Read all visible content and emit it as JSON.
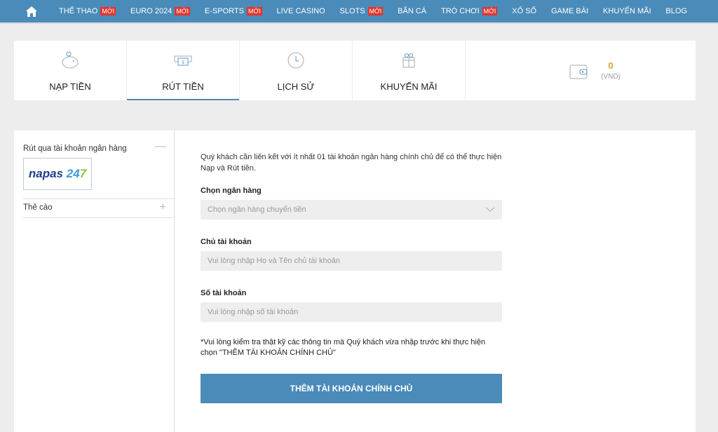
{
  "nav": {
    "items": [
      {
        "label": "THỂ THAO",
        "badge": "MỚI"
      },
      {
        "label": "EURO 2024",
        "badge": "MỚI"
      },
      {
        "label": "E-SPORTS",
        "badge": "MỚI"
      },
      {
        "label": "LIVE CASINO"
      },
      {
        "label": "SLOTS",
        "badge": "MỚI"
      },
      {
        "label": "BẮN CÁ"
      },
      {
        "label": "TRÒ CHƠI",
        "badge": "MỚI"
      },
      {
        "label": "XỔ SỐ"
      },
      {
        "label": "GAME BÀI"
      },
      {
        "label": "KHUYẾN MÃI"
      },
      {
        "label": "BLOG"
      }
    ]
  },
  "tabs": [
    {
      "label": "NẠP TIỀN",
      "icon": "piggy-bank-icon"
    },
    {
      "label": "RÚT TIỀN",
      "icon": "cash-withdraw-icon",
      "active": true
    },
    {
      "label": "LỊCH SỬ",
      "icon": "history-icon"
    },
    {
      "label": "KHUYẾN MÃI",
      "icon": "gift-icon"
    }
  ],
  "wallet": {
    "balance": "0",
    "currency": "(VND)"
  },
  "sidebar": {
    "section1": {
      "label": "Rút qua tài khoản ngân hàng",
      "logo": "napas 247"
    },
    "section2": {
      "label": "Thẻ cào"
    }
  },
  "form": {
    "intro": "Quý khách cần liên kết với ít nhất 01 tài khoản ngân hàng chính chủ để có thể thực hiện Nạp và Rút tiền.",
    "bank_label": "Chọn ngân hàng",
    "bank_placeholder": "Chọn ngân hàng chuyển tiền",
    "owner_label": "Chủ tài khoản",
    "owner_placeholder": "Vui lòng nhập Họ và Tên chủ tài khoản",
    "number_label": "Số tài khoản",
    "number_placeholder": "Vui lòng nhập số tài khoản",
    "note": "*Vui lòng kiểm tra thật kỹ các thông tin mà Quý khách vừa nhập trước khi thực hiện chọn \"THÊM TÀI KHOẢN CHÍNH CHỦ\"",
    "submit": "THÊM TÀI KHOẢN CHÍNH CHỦ"
  },
  "colors": {
    "primary": "#4a8bb9",
    "badge": "#e5332a",
    "balance": "#d8a233"
  }
}
